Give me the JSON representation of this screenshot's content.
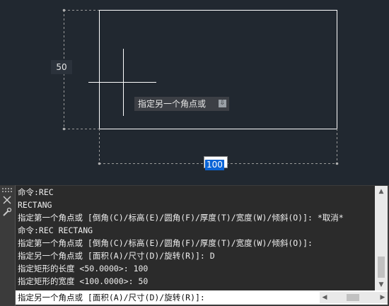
{
  "drawing": {
    "dim_height_label": "50",
    "dim_width_value": "100",
    "tooltip_text": "指定另一个角点或",
    "tooltip_icon": "download-arrow-icon",
    "colors": {
      "background": "#212830",
      "geometry": "#ffffff",
      "dimension_line": "#9a9a9a",
      "selection": "#0a64d6"
    }
  },
  "command_panel": {
    "side_icons": [
      "grip-dots-icon",
      "close-icon",
      "wrench-icon"
    ],
    "history": [
      "命令:REC",
      "RECTANG",
      "指定第一个角点或 [倒角(C)/标高(E)/圆角(F)/厚度(T)/宽度(W)/倾斜(O)]: *取消*",
      "命令:REC RECTANG",
      "指定第一个角点或 [倒角(C)/标高(E)/圆角(F)/厚度(T)/宽度(W)/倾斜(O)]:",
      "指定另一个角点或 [面积(A)/尺寸(D)/旋转(R)]: D",
      "指定矩形的长度 <50.0000>: 100",
      "指定矩形的宽度 <100.0000>: 50"
    ],
    "prompt": "指定另一个角点或 [面积(A)/尺寸(D)/旋转(R)]:"
  }
}
